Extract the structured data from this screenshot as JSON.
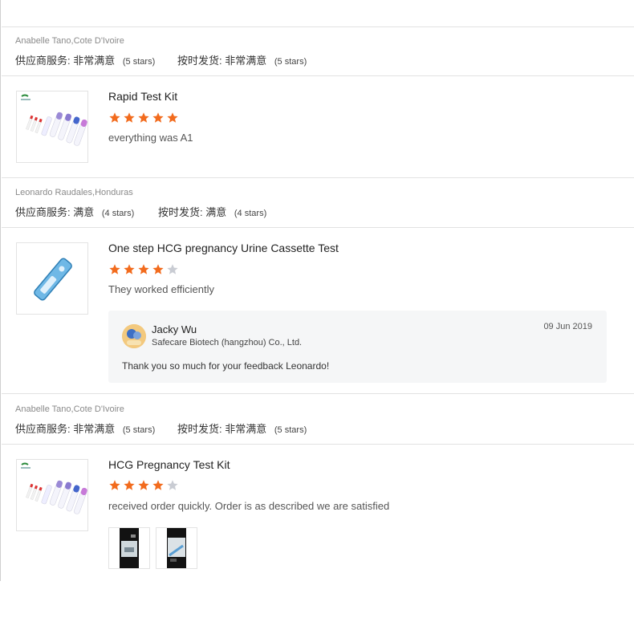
{
  "reviews": [
    {
      "buyer": "Anabelle Tano,Cote D'Ivoire",
      "supplier_service_label": "供应商服务:",
      "supplier_service_value": "非常满意",
      "supplier_service_stars": "(5 stars)",
      "ontime_label": "按时发货:",
      "ontime_value": "非常满意",
      "ontime_stars": "(5 stars)",
      "product_name": "Rapid Test Kit",
      "rating": 5,
      "comment": "everything was A1"
    },
    {
      "buyer": "Leonardo Raudales,Honduras",
      "supplier_service_label": "供应商服务:",
      "supplier_service_value": "满意",
      "supplier_service_stars": "(4 stars)",
      "ontime_label": "按时发货:",
      "ontime_value": "满意",
      "ontime_stars": "(4 stars)",
      "product_name": "One step HCG pregnancy Urine Cassette Test",
      "rating": 4,
      "comment": "They worked efficiently",
      "reply": {
        "name": "Jacky Wu",
        "company": "Safecare Biotech (hangzhou) Co., Ltd.",
        "date": "09 Jun 2019",
        "text": "Thank you so much for your feedback Leonardo!"
      }
    },
    {
      "buyer": "Anabelle Tano,Cote D'Ivoire",
      "supplier_service_label": "供应商服务:",
      "supplier_service_value": "非常满意",
      "supplier_service_stars": "(5 stars)",
      "ontime_label": "按时发货:",
      "ontime_value": "非常满意",
      "ontime_stars": "(5 stars)",
      "product_name": "HCG Pregnancy Test Kit",
      "rating": 4,
      "comment": "received order quickly. Order is as described we are satisfied",
      "photos": [
        "review-photo-1",
        "review-photo-2"
      ]
    }
  ],
  "colors": {
    "star_filled": "#f26b1d",
    "star_empty": "#c9ccd3",
    "reply_bg": "#f5f6f7"
  }
}
